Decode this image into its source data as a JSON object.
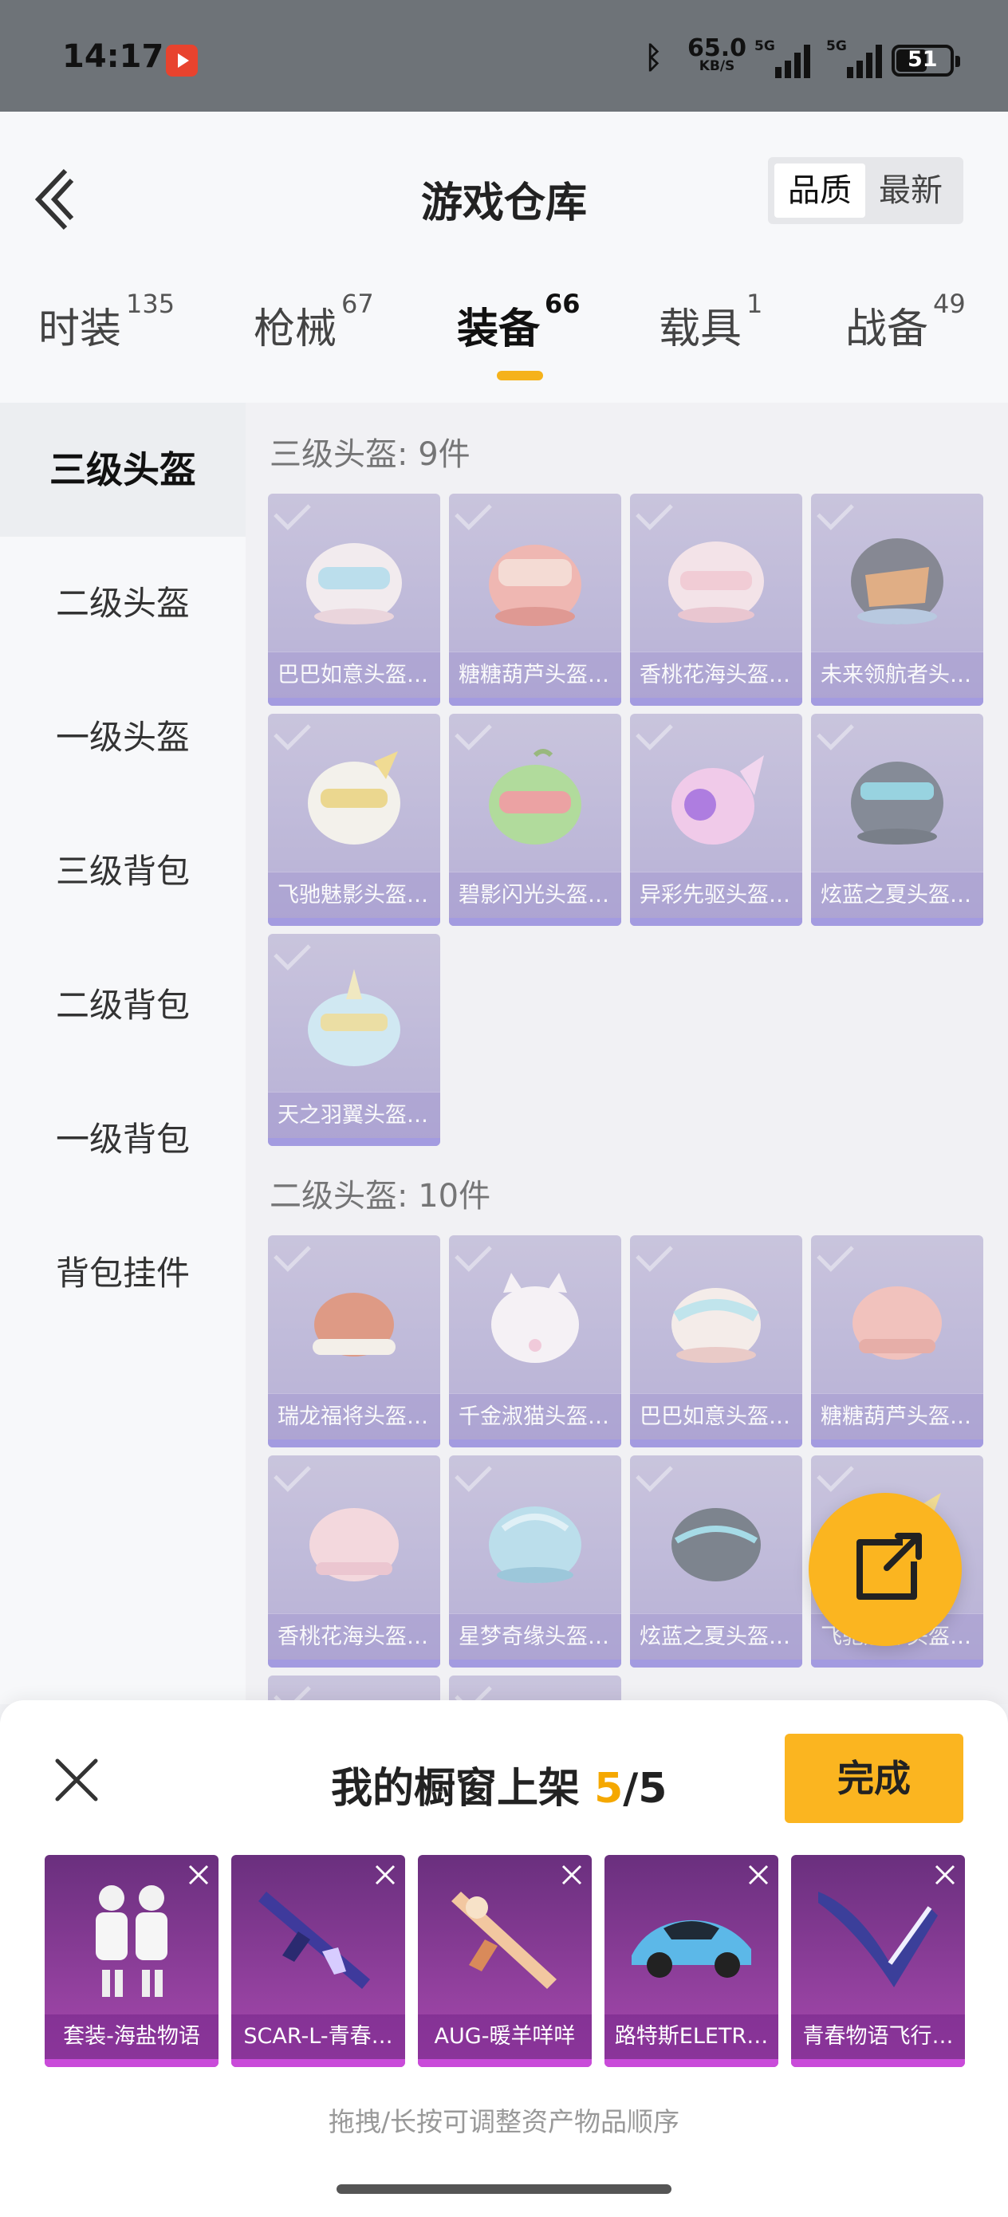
{
  "status": {
    "time": "14:17",
    "speed_value": "65.0",
    "speed_unit": "KB/S",
    "sim1": "5G",
    "sim2": "5G",
    "battery": "51"
  },
  "header": {
    "title": "游戏仓库",
    "sort_options": [
      "品质",
      "最新"
    ],
    "sort_selected": "品质"
  },
  "tabs": [
    {
      "label": "时装",
      "count": "135"
    },
    {
      "label": "枪械",
      "count": "67"
    },
    {
      "label": "装备",
      "count": "66",
      "active": true
    },
    {
      "label": "载具",
      "count": "1"
    },
    {
      "label": "战备",
      "count": "49"
    }
  ],
  "sidebar": [
    "三级头盔",
    "二级头盔",
    "一级头盔",
    "三级背包",
    "二级背包",
    "一级背包",
    "背包挂件"
  ],
  "sections": [
    {
      "title": "三级头盔: 9件",
      "items": [
        "巴巴如意头盔…",
        "糖糖葫芦头盔…",
        "香桃花海头盔…",
        "未来领航者头…",
        "飞驰魅影头盔…",
        "碧影闪光头盔…",
        "异彩先驱头盔…",
        "炫蓝之夏头盔…",
        "天之羽翼头盔…"
      ]
    },
    {
      "title": "二级头盔: 10件",
      "items": [
        "瑞龙福将头盔…",
        "千金淑猫头盔…",
        "巴巴如意头盔…",
        "糖糖葫芦头盔…",
        "香桃花海头盔…",
        "星梦奇缘头盔…",
        "炫蓝之夏头盔…",
        "飞驰魅影头盔…",
        "",
        ""
      ]
    }
  ],
  "sheet": {
    "title_prefix": "我的橱窗上架 ",
    "count": "5",
    "total": "/5",
    "done_label": "完成",
    "slots": [
      "套装-海盐物语",
      "SCAR-L-青春…",
      "AUG-暖羊咩咩",
      "路特斯ELETR…",
      "青春物语飞行…"
    ],
    "hint": "拖拽/长按可调整资产物品顺序"
  },
  "colors": {
    "accent": "#fbb520",
    "card_purple": "#988ec6",
    "slot_magenta": "#a94ab0"
  }
}
